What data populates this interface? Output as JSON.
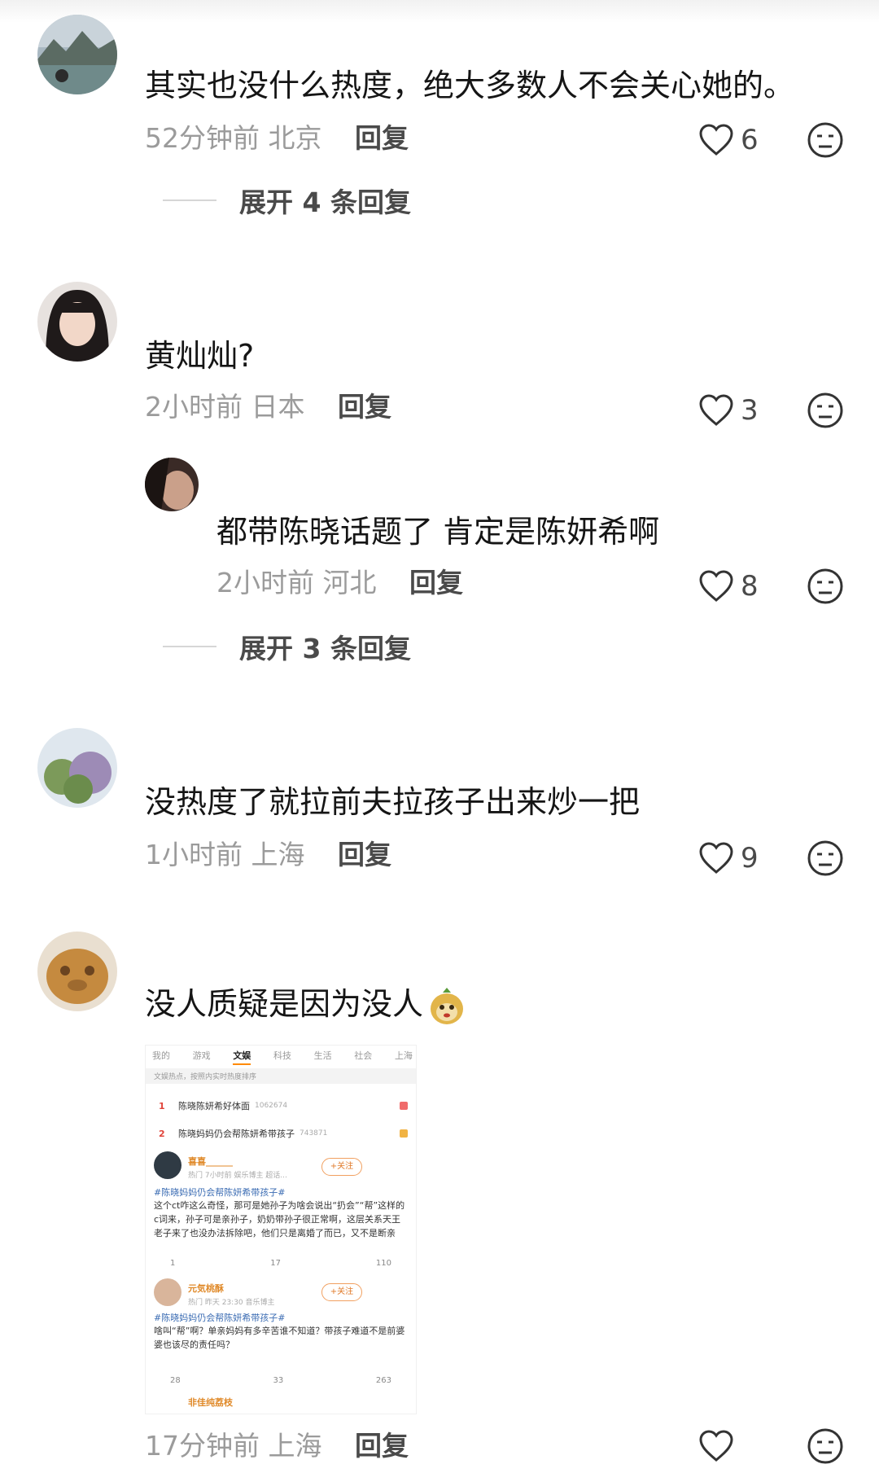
{
  "comments": [
    {
      "text": "其实也没什么热度，绝大多数人不会关心她的。",
      "time": "52分钟前",
      "location": "北京",
      "reply_label": "回复",
      "likes": "6",
      "expand_label": "展开 4 条回复"
    },
    {
      "text": "黄灿灿?",
      "time": "2小时前",
      "location": "日本",
      "reply_label": "回复",
      "likes": "3"
    },
    {
      "text": "没热度了就拉前夫拉孩子出来炒一把",
      "time": "1小时前",
      "location": "上海",
      "reply_label": "回复",
      "likes": "9"
    },
    {
      "text": "没人质疑是因为没人",
      "time": "17分钟前",
      "location": "上海",
      "reply_label": "回复",
      "likes": ""
    }
  ],
  "sub_reply": {
    "text": "都带陈晓话题了 肯定是陈妍希啊",
    "time": "2小时前",
    "location": "河北",
    "reply_label": "回复",
    "likes": "8",
    "expand_label": "展开 3 条回复"
  },
  "embedded_screenshot": {
    "tabs": [
      "我的",
      "游戏",
      "文娱",
      "科技",
      "生活",
      "社会",
      "上海"
    ],
    "hint": "文娱热点，按照内实时热度排序",
    "hot_list": [
      {
        "rank": "1",
        "title": "陈晓陈妍希好体面",
        "heat": "1062674"
      },
      {
        "rank": "2",
        "title": "陈晓妈妈仍会帮陈妍希带孩子",
        "heat": "743871"
      }
    ],
    "posts": [
      {
        "name": "喜喜______",
        "sub": "热门  7小时前  娱乐博主 超话...",
        "follow": "+关注",
        "topic": "#陈晓妈妈仍会帮陈妍希带孩子#",
        "body": "这个ct咋这么奇怪，那可是她孙子为啥会说出“扔会”“帮”这样的c词来，孙子可是亲孙子，奶奶带孙子很正常啊，这层关系天王老子来了也没办法拆除吧，他们只是离婚了而已，又不是断亲",
        "shares": "1",
        "comments": "17",
        "likes": "110"
      },
      {
        "name": "元気桃酥",
        "sub": "热门  昨天 23:30  音乐博主",
        "follow": "+关注",
        "topic": "#陈晓妈妈仍会帮陈妍希带孩子#",
        "body": "啥叫“帮”啊？单亲妈妈有多辛苦谁不知道？带孩子难道不是前婆婆也该尽的责任吗？",
        "shares": "28",
        "comments": "33",
        "likes": "263"
      }
    ],
    "third_name": "非佳纯荔枝"
  },
  "colors": {
    "meta_gray": "#9b9b9b",
    "reply_dark": "#4a4a4a",
    "weibo_orange": "#ff8a00",
    "hot_red": "#e0443a"
  }
}
